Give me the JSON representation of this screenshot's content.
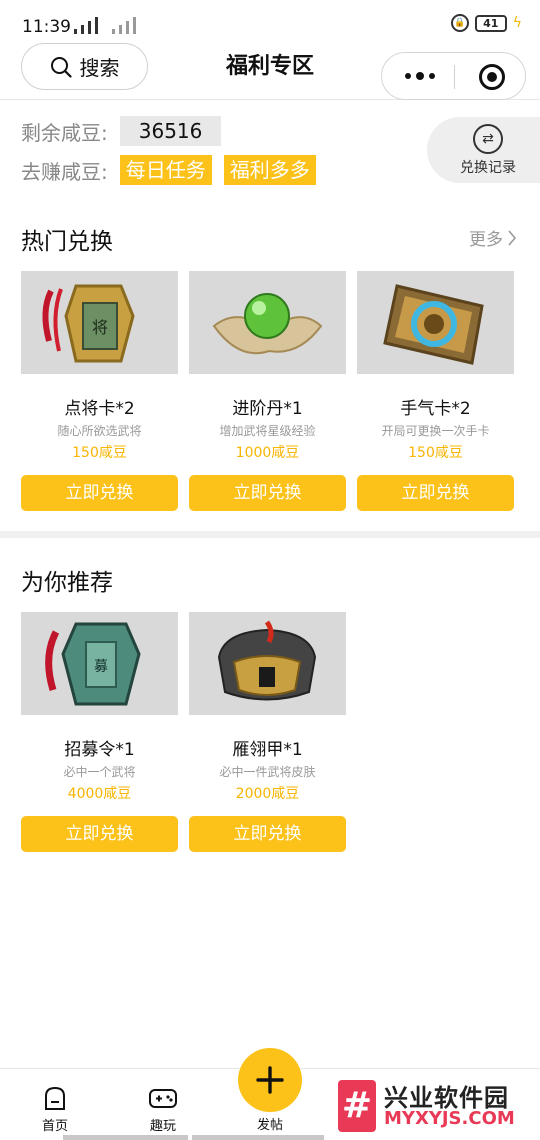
{
  "status_bar": {
    "time": "11:39",
    "battery": "41"
  },
  "header": {
    "search_label": "搜索",
    "title": "福利专区"
  },
  "balance": {
    "remaining_label": "剩余咸豆:",
    "remaining_value": "36516",
    "earn_label": "去赚咸豆:",
    "earn_tags": [
      "每日任务",
      "福利多多"
    ],
    "record_label": "兑换记录"
  },
  "hot": {
    "title": "热门兑换",
    "more_label": "更多",
    "items": [
      {
        "name": "点将卡*2",
        "desc": "随心所欲选武将",
        "price": "150咸豆",
        "button": "立即兑换"
      },
      {
        "name": "进阶丹*1",
        "desc": "增加武将星级经验",
        "price": "1000咸豆",
        "button": "立即兑换"
      },
      {
        "name": "手气卡*2",
        "desc": "开局可更换一次手卡",
        "price": "150咸豆",
        "button": "立即兑换"
      }
    ]
  },
  "recommend": {
    "title": "为你推荐",
    "items": [
      {
        "name": "招募令*1",
        "desc": "必中一个武将",
        "price": "4000咸豆",
        "button": "立即兑换"
      },
      {
        "name": "雁翎甲*1",
        "desc": "必中一件武将皮肤",
        "price": "2000咸豆",
        "button": "立即兑换"
      }
    ]
  },
  "bottom_nav": {
    "home": "首页",
    "play": "趣玩",
    "post": "发帖"
  },
  "watermark": {
    "cn": "兴业软件园",
    "en": "MYXYJS.COM"
  },
  "colors": {
    "accent": "#fcc219",
    "price": "#f7b500",
    "thumb_bg": "#d9d9d9"
  }
}
